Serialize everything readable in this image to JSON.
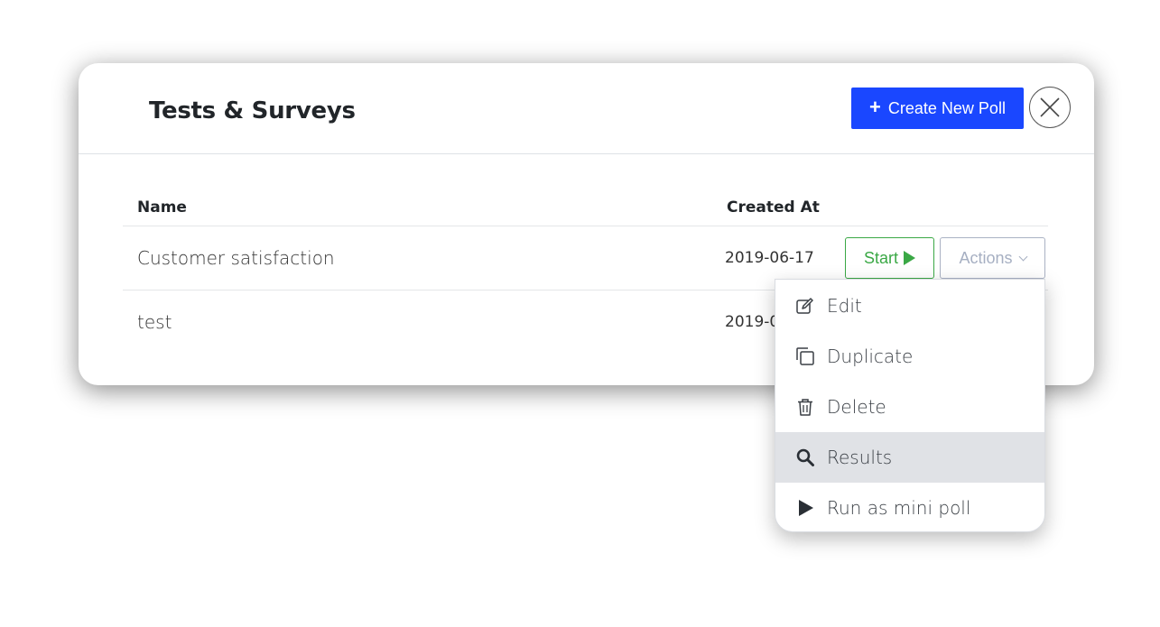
{
  "modal": {
    "title": "Tests & Surveys",
    "create_button_label": "Create New Poll"
  },
  "table": {
    "columns": [
      "Name",
      "Created At"
    ],
    "rows": [
      {
        "name": "Customer satisfaction",
        "created_at": "2019-06-17",
        "start_label": "Start",
        "actions_label": "Actions"
      },
      {
        "name": "test",
        "created_at": "2019-0"
      }
    ]
  },
  "dropdown": {
    "items": [
      {
        "label": "Edit",
        "icon": "edit-icon"
      },
      {
        "label": "Duplicate",
        "icon": "duplicate-icon"
      },
      {
        "label": "Delete",
        "icon": "trash-icon"
      },
      {
        "label": "Results",
        "icon": "search-icon",
        "active": true
      },
      {
        "label": "Run as mini poll",
        "icon": "play-icon"
      }
    ]
  },
  "colors": {
    "primary": "#1a47ff",
    "success": "#3aa845",
    "muted": "#a6afc2",
    "active_item_bg": "#e0e2e6"
  }
}
